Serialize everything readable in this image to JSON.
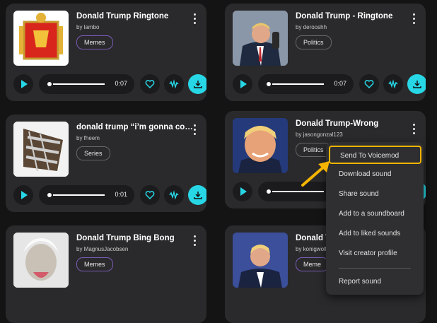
{
  "cards": [
    {
      "title": "Donald Trump Ringtone",
      "author": "by lambo",
      "tag": "Memes",
      "time": "0:07"
    },
    {
      "title": "Donald Trump - Ringtone",
      "author": "by derooshh",
      "tag": "Politics",
      "time": "0:07"
    },
    {
      "title": "donald trump “i’m gonna co…",
      "author": "by fheem",
      "tag": "Series",
      "time": "0:01"
    },
    {
      "title": "Donald Trump-Wrong",
      "author": "by jasongonzal123",
      "tag": "Politics",
      "time": ""
    },
    {
      "title": "Donald Trump Bing Bong",
      "author": "by MagnusJacobsen",
      "tag": "Memes",
      "time": ""
    },
    {
      "title": "Donald T",
      "author": "by konigwolf",
      "tag": "Meme",
      "time": ""
    }
  ],
  "menu": {
    "items": [
      "Send To Voicemod",
      "Download sound",
      "Share sound",
      "Add to a soundboard",
      "Add to liked sounds",
      "Visit creator profile",
      "Report sound"
    ]
  },
  "colors": {
    "accent": "#27d7e6",
    "highlight": "#f5b400",
    "tag_border": "#7a5bb5"
  }
}
